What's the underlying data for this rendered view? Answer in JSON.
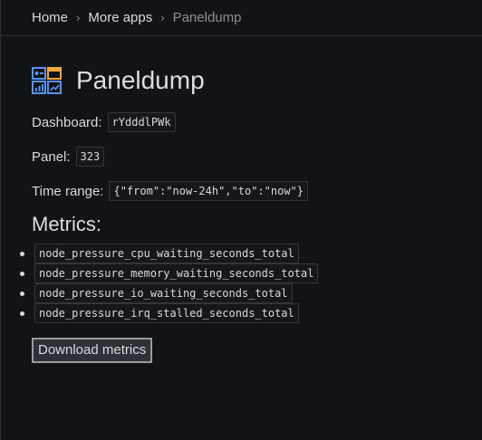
{
  "breadcrumb": {
    "home": "Home",
    "more_apps": "More apps",
    "current": "Paneldump",
    "separator": "›"
  },
  "page": {
    "title": "Paneldump",
    "icon": "paneldump-app-icon",
    "accent_color": "#5794f2",
    "accent_color_2": "#f2a83b"
  },
  "fields": {
    "dashboard_label": "Dashboard:",
    "dashboard_value": "rYdddlPWk",
    "panel_label": "Panel:",
    "panel_value": "323",
    "time_range_label": "Time range:",
    "time_range_value": "{\"from\":\"now-24h\",\"to\":\"now\"}"
  },
  "metrics": {
    "heading": "Metrics:",
    "items": [
      "node_pressure_cpu_waiting_seconds_total",
      "node_pressure_memory_waiting_seconds_total",
      "node_pressure_io_waiting_seconds_total",
      "node_pressure_irq_stalled_seconds_total"
    ]
  },
  "actions": {
    "download_label": "Download metrics"
  }
}
